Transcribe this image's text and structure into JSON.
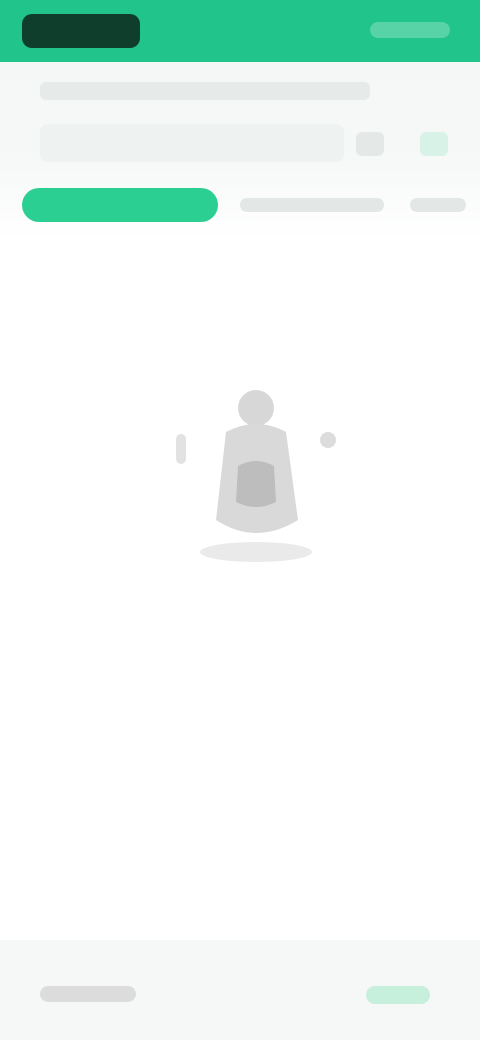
{
  "app": {
    "brand_color": "#21c48a"
  },
  "header": {
    "search_title": "",
    "search_placeholder": "",
    "filter_icon": "filter-icon",
    "cart_icon": "cart-icon"
  },
  "tabs": [
    {
      "label": "",
      "active": true
    },
    {
      "label": "",
      "active": false
    },
    {
      "label": "",
      "active": false
    }
  ],
  "empty_state": {
    "illustration": "empty-bag-illustration",
    "title": "",
    "description": ""
  },
  "footer": {
    "left_label": "",
    "right_label": ""
  }
}
